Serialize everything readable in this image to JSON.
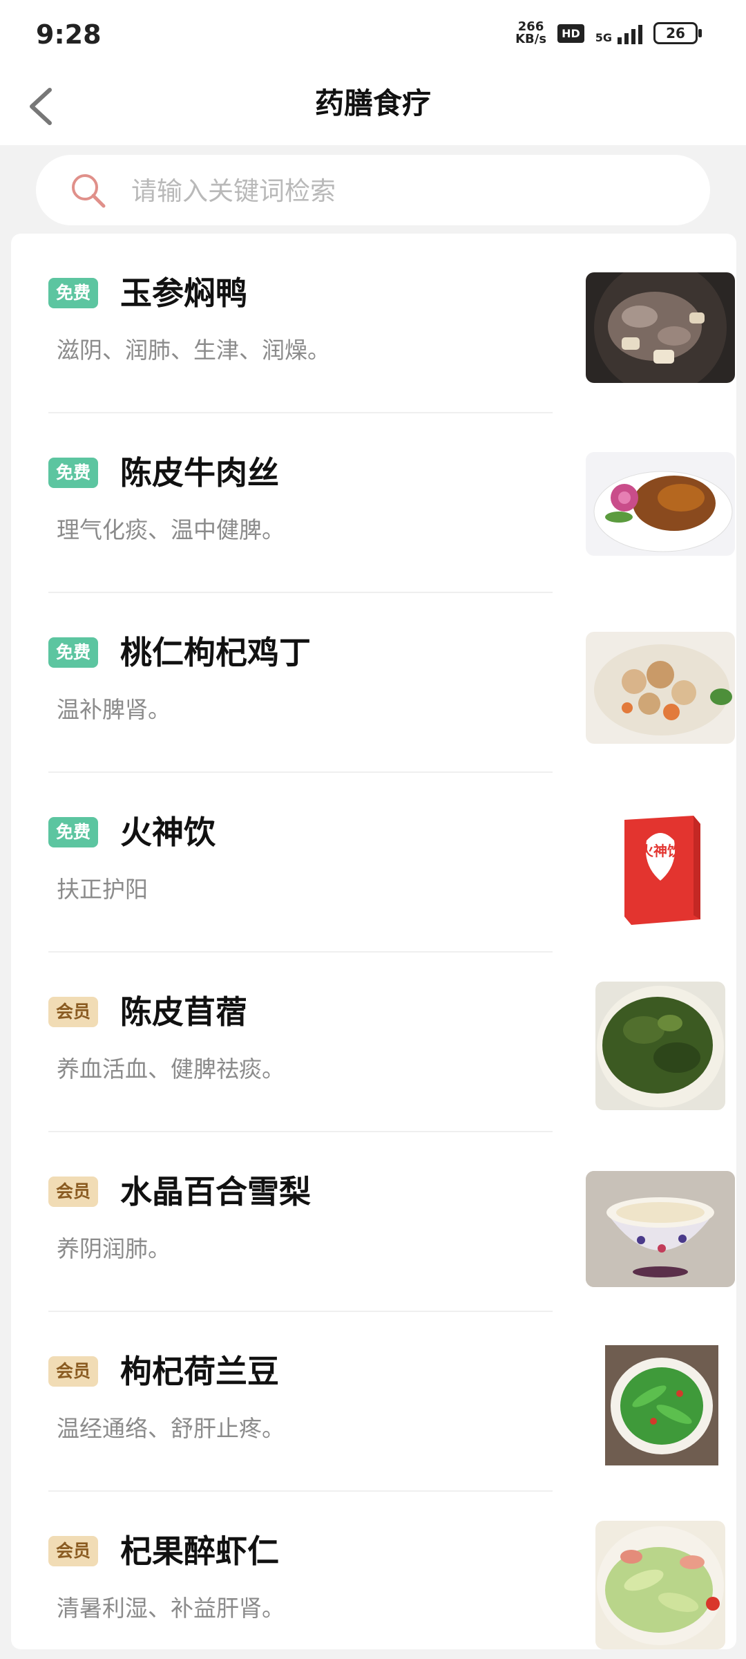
{
  "status": {
    "time": "9:28",
    "net_speed_top": "266",
    "net_speed_bottom": "KB/s",
    "hd": "HD",
    "network": "5G",
    "battery": "26"
  },
  "header": {
    "title": "药膳食疗"
  },
  "search": {
    "placeholder": "请输入关键词检索"
  },
  "items": [
    {
      "badge": "免费",
      "tier": "free",
      "title": "玉参焖鸭",
      "desc": "滋阴、润肺、生津、润燥。",
      "thumb": "braised-duck-photo"
    },
    {
      "badge": "免费",
      "tier": "free",
      "title": "陈皮牛肉丝",
      "desc": "理气化痰、温中健脾。",
      "thumb": "beef-shreds-photo"
    },
    {
      "badge": "免费",
      "tier": "free",
      "title": "桃仁枸杞鸡丁",
      "desc": "温补脾肾。",
      "thumb": "chicken-dice-photo"
    },
    {
      "badge": "免费",
      "tier": "free",
      "title": "火神饮",
      "desc": "扶正护阳",
      "thumb": "drink-box-photo",
      "thumb_text": "火神饮"
    },
    {
      "badge": "会员",
      "tier": "vip",
      "title": "陈皮苜蓿",
      "desc": "养血活血、健脾祛痰。",
      "thumb": "alfalfa-photo"
    },
    {
      "badge": "会员",
      "tier": "vip",
      "title": "水晶百合雪梨",
      "desc": "养阴润肺。",
      "thumb": "lily-pear-soup-photo"
    },
    {
      "badge": "会员",
      "tier": "vip",
      "title": "枸杞荷兰豆",
      "desc": "温经通络、舒肝止疼。",
      "thumb": "snow-peas-photo"
    },
    {
      "badge": "会员",
      "tier": "vip",
      "title": "杞果醉虾仁",
      "desc": "清暑利湿、补益肝肾。",
      "thumb": "shrimp-dish-photo"
    }
  ],
  "colors": {
    "free_badge": "#5cc5a0",
    "vip_badge": "#f1dcb5",
    "vip_text": "#8a5b21",
    "search_icon": "#e0908a"
  }
}
